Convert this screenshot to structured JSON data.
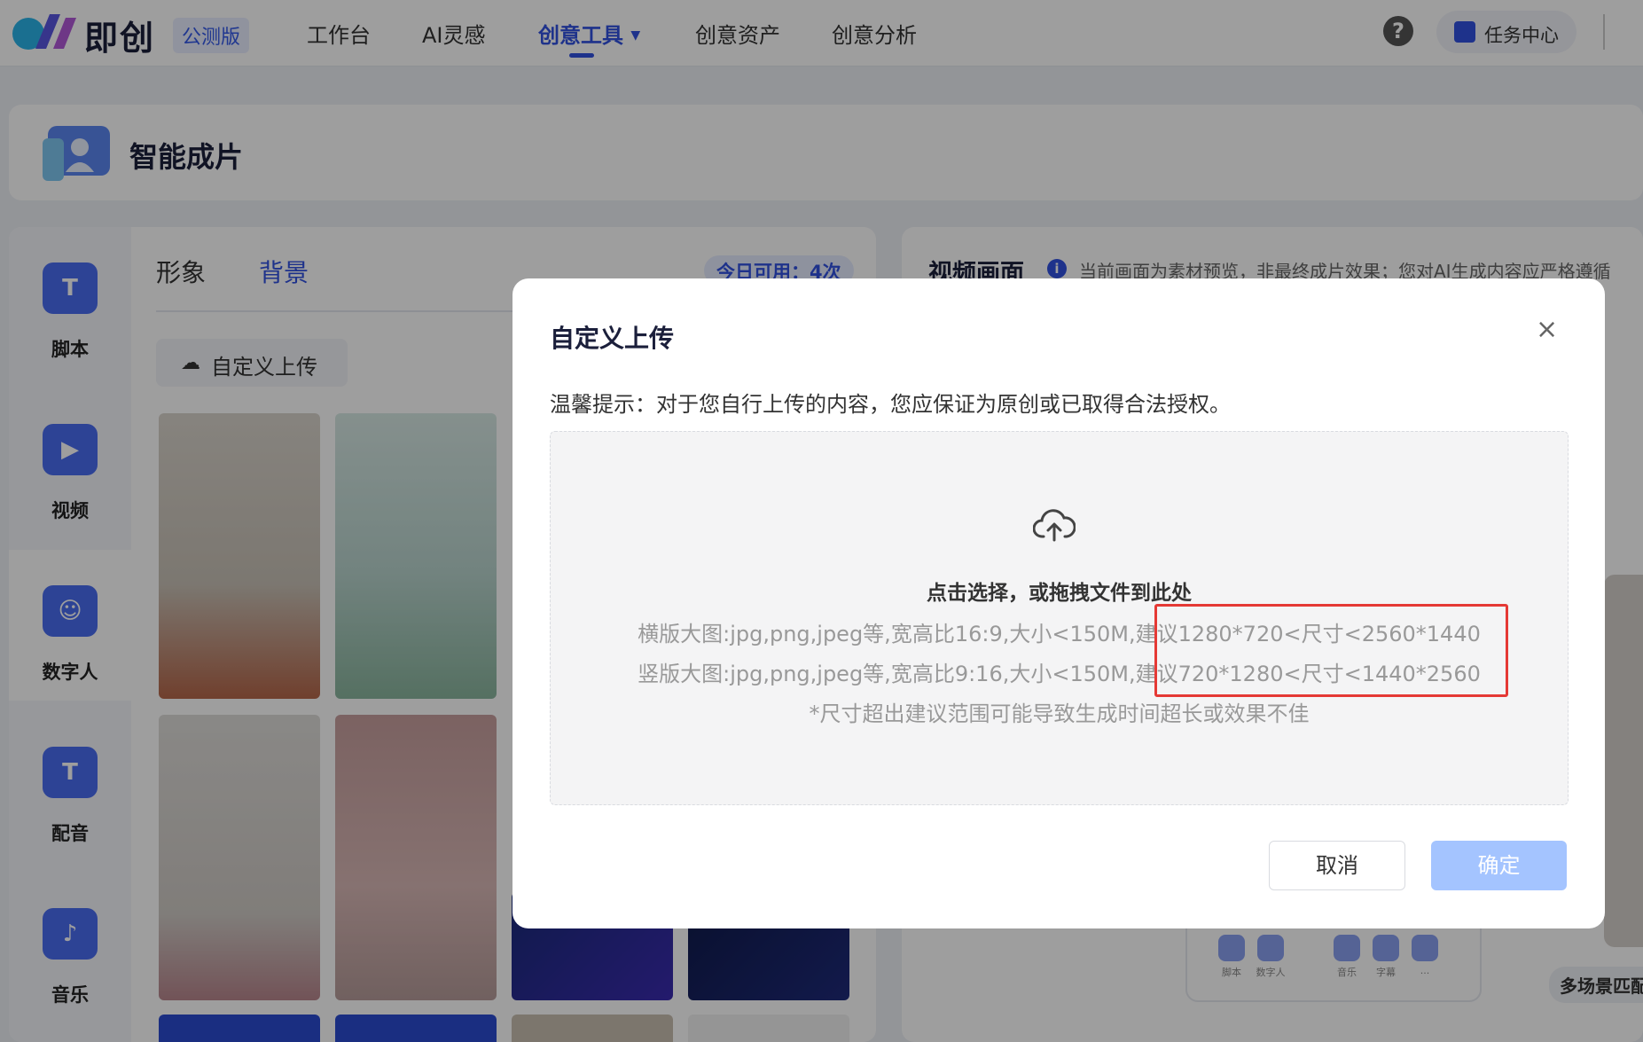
{
  "brand": {
    "name": "即创",
    "badge": "公测版"
  },
  "nav": {
    "items": [
      "工作台",
      "AI灵感",
      "创意工具",
      "创意资产",
      "创意分析"
    ],
    "active_index": 2
  },
  "topbar": {
    "help": "?",
    "task_center": "任务中心"
  },
  "header": {
    "title": "智能成片"
  },
  "sidebar": {
    "items": [
      {
        "label": "脚本",
        "icon": "script-icon",
        "glyph": "T"
      },
      {
        "label": "视频",
        "icon": "video-icon",
        "glyph": "▶"
      },
      {
        "label": "数字人",
        "icon": "digital-human-icon",
        "glyph": "☺"
      },
      {
        "label": "配音",
        "icon": "voice-icon",
        "glyph": "T"
      },
      {
        "label": "音乐",
        "icon": "music-icon",
        "glyph": "♪"
      }
    ],
    "active_index": 2
  },
  "left_panel": {
    "tabs": [
      "形象",
      "背景"
    ],
    "active_tab": 1,
    "quota": "今日可用：4次",
    "upload_button": "自定义上传",
    "thumbnails": [
      {
        "name": "living-room-orange-sofa",
        "colors": [
          "#d9d4cc",
          "#b5674a"
        ]
      },
      {
        "name": "living-room-green-sofa",
        "colors": [
          "#cfe0dc",
          "#8ab59e"
        ]
      },
      {
        "name": "room-grey-pink-chairs",
        "colors": [
          "#d9d6d3",
          "#b8868d"
        ]
      },
      {
        "name": "room-pink-walls",
        "colors": [
          "#d9b8b6",
          "#b69c9a"
        ]
      }
    ]
  },
  "right_panel": {
    "title": "视频画面",
    "note": "当前画面为素材预览，非最终成片效果；您对AI生成内容应严格遵循",
    "toolbar": [
      "脚本",
      "数字人",
      "音乐",
      "字幕",
      "..."
    ],
    "tag": "多场景匹配"
  },
  "modal": {
    "title": "自定义上传",
    "close": "×",
    "tip": "温馨提示：对于您自行上传的内容，您应保证为原创或已取得合法授权。",
    "dropzone": {
      "main": "点击选择，或拖拽文件到此处",
      "line1": "横版大图:jpg,png,jpeg等,宽高比16:9,大小<150M,建议1280*720<尺寸<2560*1440",
      "line2": "竖版大图:jpg,png,jpeg等,宽高比9:16,大小<150M,建议720*1280<尺寸<1440*2560",
      "line3": "*尺寸超出建议范围可能导致生成时间超长或效果不佳"
    },
    "cancel": "取消",
    "confirm": "确定"
  },
  "colors": {
    "accent": "#3151e0",
    "confirm_disabled": "#a4c4ff",
    "highlight": "#e53935"
  }
}
